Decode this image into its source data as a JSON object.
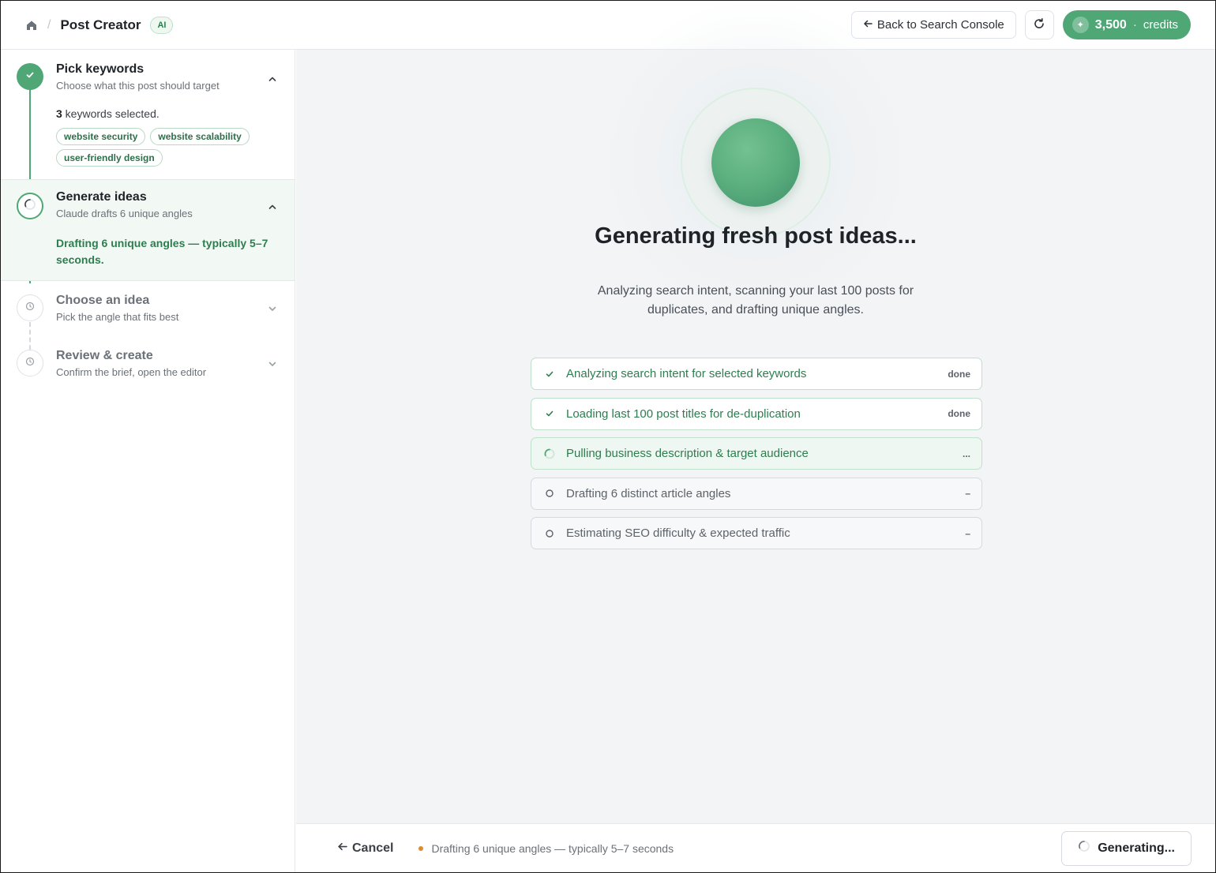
{
  "header": {
    "crumb_title": "Post Creator",
    "ai_badge": "AI",
    "back_label": "Back to Search Console",
    "credits_amount": "3,500",
    "credits_separator": "·",
    "credits_label": "credits",
    "icons": {
      "home": "home-icon",
      "back": "arrow-left-icon",
      "refresh": "refresh-icon",
      "credits": "sparkle-icon"
    }
  },
  "sidebar": {
    "steps": [
      {
        "title": "Pick keywords",
        "subtitle": "Choose what this post should target",
        "state": "complete",
        "kw_count": "3",
        "kw_count_suffix": " keywords selected.",
        "keywords": [
          "website security",
          "website scalability",
          "user-friendly design"
        ]
      },
      {
        "title": "Generate ideas",
        "subtitle": "Claude drafts 6 unique angles",
        "state": "active",
        "note": "Drafting 6 unique angles — typically 5–7 seconds."
      },
      {
        "title": "Choose an idea",
        "subtitle": "Pick the angle that fits best",
        "state": "pending"
      },
      {
        "title": "Review & create",
        "subtitle": "Confirm the brief, open the editor",
        "state": "pending"
      }
    ]
  },
  "main": {
    "title": "Generating fresh post ideas...",
    "description": "Analyzing search intent, scanning your last 100 posts for duplicates, and drafting unique angles.",
    "tasks": [
      {
        "label": "Analyzing search intent for selected keywords",
        "status": "done",
        "state": "done"
      },
      {
        "label": "Loading last 100 post titles for de-duplication",
        "status": "done",
        "state": "done"
      },
      {
        "label": "Pulling business description & target audience",
        "status": "...",
        "state": "active"
      },
      {
        "label": "Drafting 6 distinct article angles",
        "status": "–",
        "state": "pending"
      },
      {
        "label": "Estimating SEO difficulty & expected traffic",
        "status": "–",
        "state": "pending"
      }
    ]
  },
  "footer": {
    "cancel_label": "Cancel",
    "status_text": "Drafting 6 unique angles — typically 5–7 seconds",
    "generating_label": "Generating..."
  },
  "colors": {
    "accent": "#4fa775",
    "accent_dark": "#2e7d4f",
    "status_dot": "#e08a2b",
    "background": "#f3f4f6"
  }
}
